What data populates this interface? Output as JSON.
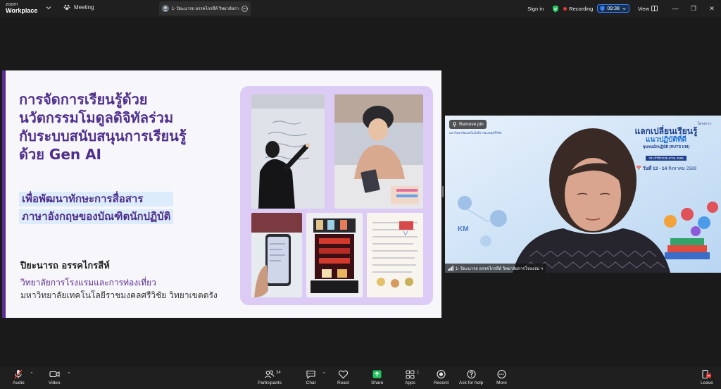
{
  "app": {
    "brand_small": "zoom",
    "brand_large": "Workplace"
  },
  "top": {
    "meeting_label": "Meeting",
    "tab_title": "1- ปิยะนารถ  อรรคไกรสีห์  วิทยาลัยการโร",
    "signin": "Sign in",
    "recording": "Recording",
    "timer": "09:38",
    "view": "View"
  },
  "slide": {
    "title_lines": [
      "การจัดการเรียนรู้ด้วย",
      "นวัตกรรมโมดูลดิจิทัลร่วม",
      "กับระบบสนับสนุนการเรียนรู้",
      "ด้วย Gen AI"
    ],
    "subtitle_lines": [
      "เพื่อพัฒนาทักษะการสื่อสาร",
      "ภาษาอังกฤษของบัณฑิตนักปฏิบัติ"
    ],
    "author": "ปิยะนารถ  อรรคไกรสีห์",
    "affiliation_1": "วิทยาลัยการโรงแรมและการท่องเที่ยว",
    "affiliation_2": "มหาวิทยาลัยเทคโนโลยีราชมงคลศรีวิชัย วิทยาเขตตรัง"
  },
  "video": {
    "remove_pin": "Remove pin",
    "banner_project": "โครงการ",
    "banner_title_1": "แลกเปลี่ยนเรียนรู้",
    "banner_title_2": "แนวปฏิบัติที่ดี",
    "banner_title_3": "ชุมชนนักปฏิบัติ (RUTS KM)",
    "banner_year": "ประจำปีงบประมาณ 2569",
    "banner_date_day": "วันที่ 13 - 14",
    "banner_date_month": "สิงหาคม 2569",
    "banner_org": "มหาวิทยาลัยเทคโนโลยีราชมงคลศรีวิชัย",
    "km_label": "KM",
    "participant_name": "1- ปิยะนารถ  อรรคไกรสีห์  วิทยาลัยการโรงแรม ฯ"
  },
  "toolbar": {
    "audio": "Audio",
    "video": "Video",
    "participants": "Participants",
    "participants_count": "34",
    "chat": "Chat",
    "react": "React",
    "share": "Share",
    "apps": "Apps",
    "apps_count": "1",
    "record": "Record",
    "ask_for_help": "Ask for help",
    "more": "More",
    "leave": "Leave"
  },
  "colors": {
    "slide_purple": "#4f2f8c",
    "subtitle_bg": "#dcecfb",
    "photo_frame": "#dccbf5",
    "share_green": "#22c55e",
    "leave_red": "#e53935",
    "timer_blue": "#3b82f6"
  }
}
